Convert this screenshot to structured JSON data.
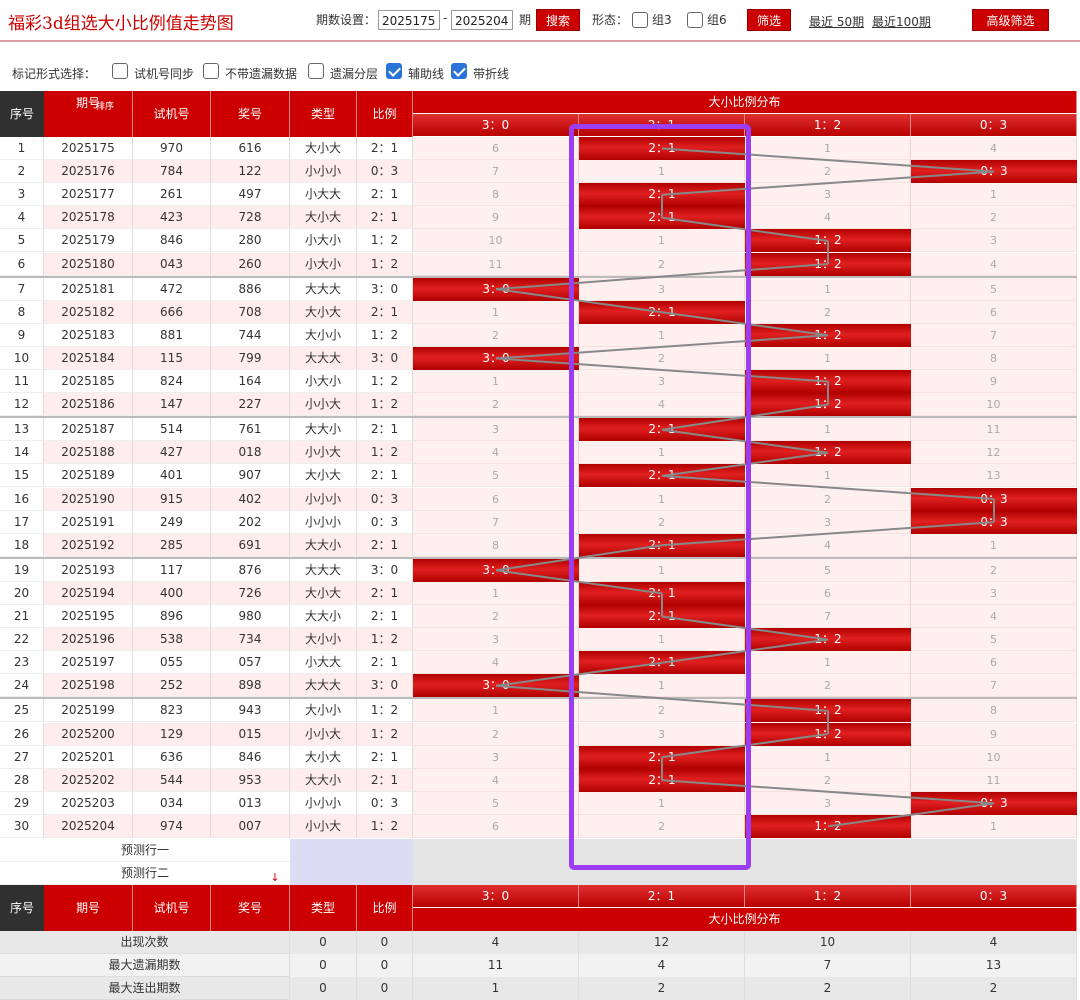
{
  "title": "福彩3d组选大小比例值走势图",
  "controls": {
    "period_setting_label": "期数设置：",
    "start_value": "2025175",
    "dash": "-",
    "end_value": "2025204",
    "period_unit": "期",
    "search_button": "搜索",
    "form_label": "形态：",
    "group3_label": "组3",
    "group6_label": "组6",
    "filter_button": "筛选",
    "recent50_link": "最近 50期",
    "recent100_link": "最近100期",
    "advanced_button": "高级筛选"
  },
  "options": {
    "label": "标记形式选择：",
    "items": [
      {
        "label": "试机号同步",
        "checked": false
      },
      {
        "label": "不带遗漏数据",
        "checked": false
      },
      {
        "label": "遗漏分层",
        "checked": false
      },
      {
        "label": "辅助线",
        "checked": true
      },
      {
        "label": "带折线",
        "checked": true
      }
    ]
  },
  "table": {
    "headers": {
      "seq": "序号",
      "issue": "期号",
      "sort": "排序",
      "trial": "试机号",
      "prize": "奖号",
      "type": "类型",
      "ratio": "比例",
      "dist": "大小比例分布"
    },
    "dist_cols": [
      "3：0",
      "2：1",
      "1：2",
      "0：3"
    ],
    "rows": [
      {
        "seq": "1",
        "issue": "2025175",
        "trial": "970",
        "prize": "616",
        "type": "大小大",
        "ratio": "2：1",
        "dist": [
          "6",
          "2：1",
          "1",
          "4"
        ]
      },
      {
        "seq": "2",
        "issue": "2025176",
        "trial": "784",
        "prize": "122",
        "type": "小小小",
        "ratio": "0：3",
        "dist": [
          "7",
          "1",
          "2",
          "0：3"
        ]
      },
      {
        "seq": "3",
        "issue": "2025177",
        "trial": "261",
        "prize": "497",
        "type": "小大大",
        "ratio": "2：1",
        "dist": [
          "8",
          "2：1",
          "3",
          "1"
        ]
      },
      {
        "seq": "4",
        "issue": "2025178",
        "trial": "423",
        "prize": "728",
        "type": "大小大",
        "ratio": "2：1",
        "dist": [
          "9",
          "2：1",
          "4",
          "2"
        ]
      },
      {
        "seq": "5",
        "issue": "2025179",
        "trial": "846",
        "prize": "280",
        "type": "小大小",
        "ratio": "1：2",
        "dist": [
          "10",
          "1",
          "1：2",
          "3"
        ]
      },
      {
        "seq": "6",
        "issue": "2025180",
        "trial": "043",
        "prize": "260",
        "type": "小大小",
        "ratio": "1：2",
        "dist": [
          "11",
          "2",
          "1：2",
          "4"
        ]
      },
      {
        "seq": "7",
        "issue": "2025181",
        "trial": "472",
        "prize": "886",
        "type": "大大大",
        "ratio": "3：0",
        "dist": [
          "3：0",
          "3",
          "1",
          "5"
        ]
      },
      {
        "seq": "8",
        "issue": "2025182",
        "trial": "666",
        "prize": "708",
        "type": "大小大",
        "ratio": "2：1",
        "dist": [
          "1",
          "2：1",
          "2",
          "6"
        ]
      },
      {
        "seq": "9",
        "issue": "2025183",
        "trial": "881",
        "prize": "744",
        "type": "大小小",
        "ratio": "1：2",
        "dist": [
          "2",
          "1",
          "1：2",
          "7"
        ]
      },
      {
        "seq": "10",
        "issue": "2025184",
        "trial": "115",
        "prize": "799",
        "type": "大大大",
        "ratio": "3：0",
        "dist": [
          "3：0",
          "2",
          "1",
          "8"
        ]
      },
      {
        "seq": "11",
        "issue": "2025185",
        "trial": "824",
        "prize": "164",
        "type": "小大小",
        "ratio": "1：2",
        "dist": [
          "1",
          "3",
          "1：2",
          "9"
        ]
      },
      {
        "seq": "12",
        "issue": "2025186",
        "trial": "147",
        "prize": "227",
        "type": "小小大",
        "ratio": "1：2",
        "dist": [
          "2",
          "4",
          "1：2",
          "10"
        ]
      },
      {
        "seq": "13",
        "issue": "2025187",
        "trial": "514",
        "prize": "761",
        "type": "大大小",
        "ratio": "2：1",
        "dist": [
          "3",
          "2：1",
          "1",
          "11"
        ]
      },
      {
        "seq": "14",
        "issue": "2025188",
        "trial": "427",
        "prize": "018",
        "type": "小小大",
        "ratio": "1：2",
        "dist": [
          "4",
          "1",
          "1：2",
          "12"
        ]
      },
      {
        "seq": "15",
        "issue": "2025189",
        "trial": "401",
        "prize": "907",
        "type": "大小大",
        "ratio": "2：1",
        "dist": [
          "5",
          "2：1",
          "1",
          "13"
        ]
      },
      {
        "seq": "16",
        "issue": "2025190",
        "trial": "915",
        "prize": "402",
        "type": "小小小",
        "ratio": "0：3",
        "dist": [
          "6",
          "1",
          "2",
          "0：3"
        ]
      },
      {
        "seq": "17",
        "issue": "2025191",
        "trial": "249",
        "prize": "202",
        "type": "小小小",
        "ratio": "0：3",
        "dist": [
          "7",
          "2",
          "3",
          "0：3"
        ]
      },
      {
        "seq": "18",
        "issue": "2025192",
        "trial": "285",
        "prize": "691",
        "type": "大大小",
        "ratio": "2：1",
        "dist": [
          "8",
          "2：1",
          "4",
          "1"
        ]
      },
      {
        "seq": "19",
        "issue": "2025193",
        "trial": "117",
        "prize": "876",
        "type": "大大大",
        "ratio": "3：0",
        "dist": [
          "3：0",
          "1",
          "5",
          "2"
        ]
      },
      {
        "seq": "20",
        "issue": "2025194",
        "trial": "400",
        "prize": "726",
        "type": "大小大",
        "ratio": "2：1",
        "dist": [
          "1",
          "2：1",
          "6",
          "3"
        ]
      },
      {
        "seq": "21",
        "issue": "2025195",
        "trial": "896",
        "prize": "980",
        "type": "大大小",
        "ratio": "2：1",
        "dist": [
          "2",
          "2：1",
          "7",
          "4"
        ]
      },
      {
        "seq": "22",
        "issue": "2025196",
        "trial": "538",
        "prize": "734",
        "type": "大小小",
        "ratio": "1：2",
        "dist": [
          "3",
          "1",
          "1：2",
          "5"
        ]
      },
      {
        "seq": "23",
        "issue": "2025197",
        "trial": "055",
        "prize": "057",
        "type": "小大大",
        "ratio": "2：1",
        "dist": [
          "4",
          "2：1",
          "1",
          "6"
        ]
      },
      {
        "seq": "24",
        "issue": "2025198",
        "trial": "252",
        "prize": "898",
        "type": "大大大",
        "ratio": "3：0",
        "dist": [
          "3：0",
          "1",
          "2",
          "7"
        ]
      },
      {
        "seq": "25",
        "issue": "2025199",
        "trial": "823",
        "prize": "943",
        "type": "大小小",
        "ratio": "1：2",
        "dist": [
          "1",
          "2",
          "1：2",
          "8"
        ]
      },
      {
        "seq": "26",
        "issue": "2025200",
        "trial": "129",
        "prize": "015",
        "type": "小小大",
        "ratio": "1：2",
        "dist": [
          "2",
          "3",
          "1：2",
          "9"
        ]
      },
      {
        "seq": "27",
        "issue": "2025201",
        "trial": "636",
        "prize": "846",
        "type": "大小大",
        "ratio": "2：1",
        "dist": [
          "3",
          "2：1",
          "1",
          "10"
        ]
      },
      {
        "seq": "28",
        "issue": "2025202",
        "trial": "544",
        "prize": "953",
        "type": "大大小",
        "ratio": "2：1",
        "dist": [
          "4",
          "2：1",
          "2",
          "11"
        ]
      },
      {
        "seq": "29",
        "issue": "2025203",
        "trial": "034",
        "prize": "013",
        "type": "小小小",
        "ratio": "0：3",
        "dist": [
          "5",
          "1",
          "3",
          "0：3"
        ]
      },
      {
        "seq": "30",
        "issue": "2025204",
        "trial": "974",
        "prize": "007",
        "type": "小小大",
        "ratio": "1：2",
        "dist": [
          "6",
          "2",
          "1：2",
          "1"
        ]
      }
    ],
    "predict_rows": [
      "预测行一",
      "预测行二"
    ],
    "stats": [
      {
        "label": "出现次数",
        "type": "0",
        "ratio": "0",
        "values": [
          "4",
          "12",
          "10",
          "4"
        ]
      },
      {
        "label": "最大遗漏期数",
        "type": "0",
        "ratio": "0",
        "values": [
          "11",
          "4",
          "7",
          "13"
        ]
      },
      {
        "label": "最大连出期数",
        "type": "0",
        "ratio": "0",
        "values": [
          "1",
          "2",
          "2",
          "2"
        ]
      }
    ]
  },
  "colors": {
    "accent": "#cc0000",
    "header_dark": "#303030",
    "highlight": "#9b3df0",
    "row_pink": "#ffecec"
  }
}
